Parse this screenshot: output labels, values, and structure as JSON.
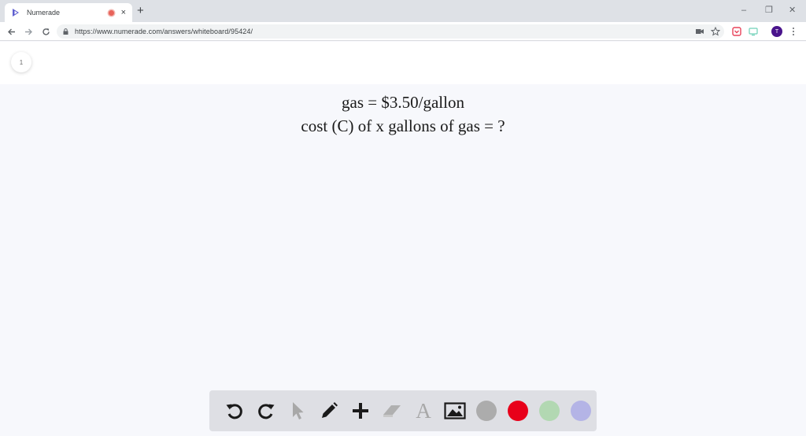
{
  "browser": {
    "tab_title": "Numerade",
    "tab_close": "×",
    "new_tab": "+",
    "window_controls": {
      "minimize": "–",
      "restore": "❐",
      "close": "✕"
    },
    "url": "https://www.numerade.com/answers/whiteboard/95424/",
    "avatar_initial": "T",
    "colors": {
      "favicon": "#5f5fd0",
      "recording": "#e8635a",
      "avatar": "#4a148c"
    }
  },
  "whiteboard": {
    "page_number": "1",
    "lines": [
      "gas = $3.50/gallon",
      "cost (C) of x gallons of gas = ?"
    ]
  },
  "palette": {
    "tools": [
      "undo-icon",
      "redo-icon",
      "pointer-icon",
      "pen-icon",
      "add-icon",
      "eraser-icon",
      "text-icon",
      "image-icon"
    ],
    "text_tool_glyph": "A",
    "colors": [
      "#acacac",
      "#e8001a",
      "#b2d8b2",
      "#b4b4e6"
    ]
  }
}
